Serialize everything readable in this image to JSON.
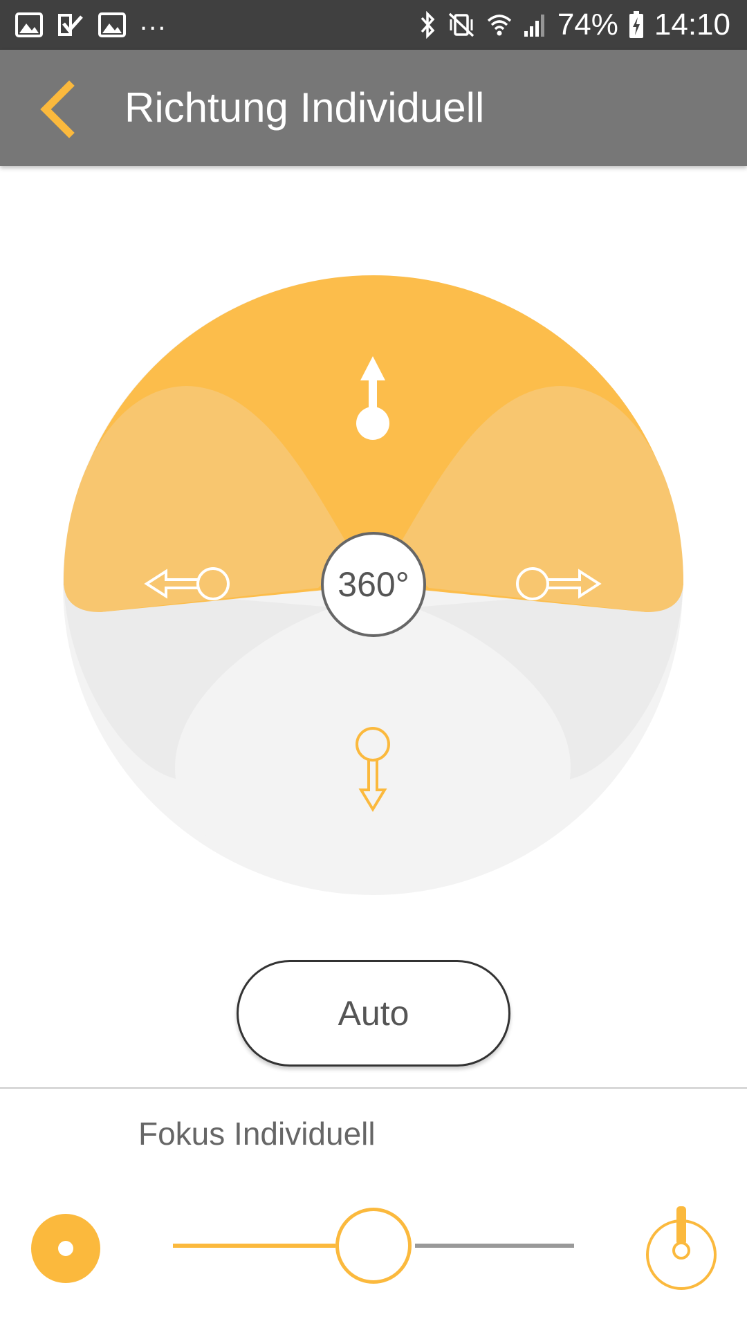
{
  "status_bar": {
    "notification_icons": [
      "image-icon",
      "check-task-icon",
      "image-icon"
    ],
    "overflow": "...",
    "system_icons": [
      "bluetooth-icon",
      "vibrate-mute-icon",
      "wifi-icon",
      "signal-icon"
    ],
    "battery_percent": "74%",
    "time": "14:10"
  },
  "app_bar": {
    "back_icon": "chevron-left-icon",
    "title": "Richtung Individuell"
  },
  "direction_dial": {
    "center_label": "360°",
    "directions": [
      {
        "name": "up",
        "active": true,
        "icon": "arrow-up-icon"
      },
      {
        "name": "left",
        "active": true,
        "icon": "arrow-left-icon"
      },
      {
        "name": "right",
        "active": true,
        "icon": "arrow-right-icon"
      },
      {
        "name": "down",
        "active": false,
        "icon": "arrow-down-icon"
      }
    ]
  },
  "auto_button": {
    "label": "Auto"
  },
  "focus": {
    "label": "Fokus Individuell",
    "slider_value": 0.5,
    "min_icon": "wide-beam-icon",
    "max_icon": "focused-beam-icon"
  },
  "colors": {
    "accent": "#fbb93d",
    "active_petal": "#f8c66f",
    "inactive_area": "#f3f3f3",
    "inactive_petal": "#ebebeb",
    "app_bar": "#777777",
    "status_bar": "#404040"
  }
}
